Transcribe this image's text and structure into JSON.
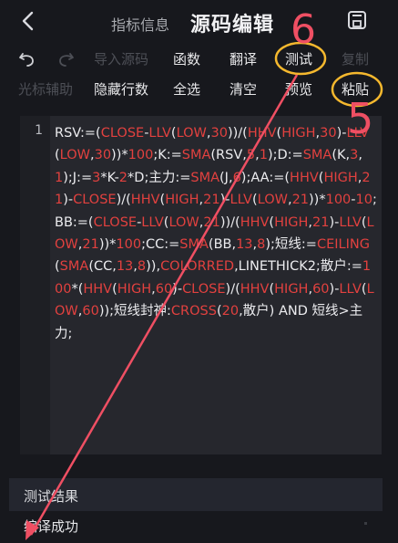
{
  "header": {
    "subtitle": "指标信息",
    "title": "源码编辑"
  },
  "toolbar": {
    "row1": {
      "import": "导入源码",
      "functions": "函数",
      "translate": "翻译",
      "test": "测试",
      "copy": "复制"
    },
    "row2": {
      "cursor_assist": "光标辅助",
      "hide_lines": "隐藏行数",
      "select_all": "全选",
      "clear": "清空",
      "preview": "预览",
      "paste": "粘贴"
    }
  },
  "editor": {
    "line_number": "1",
    "code_segments": [
      [
        "w",
        "RSV:=("
      ],
      [
        "r",
        "CLOSE"
      ],
      [
        "w",
        "-"
      ],
      [
        "r",
        "LLV"
      ],
      [
        "w",
        "("
      ],
      [
        "r",
        "LOW"
      ],
      [
        "w",
        ","
      ],
      [
        "r",
        "30"
      ],
      [
        "w",
        "))/("
      ],
      [
        "r",
        "HHV"
      ],
      [
        "w",
        "("
      ],
      [
        "r",
        "HIGH"
      ],
      [
        "w",
        ","
      ],
      [
        "r",
        "30"
      ],
      [
        "w",
        ")-"
      ],
      [
        "r",
        "LLV"
      ],
      [
        "w",
        "("
      ],
      [
        "r",
        "LOW"
      ],
      [
        "w",
        ","
      ],
      [
        "r",
        "30"
      ],
      [
        "w",
        "))*"
      ],
      [
        "r",
        "100"
      ],
      [
        "w",
        ";K:="
      ],
      [
        "r",
        "SMA"
      ],
      [
        "w",
        "(RSV,"
      ],
      [
        "r",
        "5"
      ],
      [
        "w",
        ","
      ],
      [
        "r",
        "1"
      ],
      [
        "w",
        ");D:="
      ],
      [
        "r",
        "SMA"
      ],
      [
        "w",
        "(K,"
      ],
      [
        "r",
        "3"
      ],
      [
        "w",
        ","
      ],
      [
        "r",
        "1"
      ],
      [
        "w",
        ");J:="
      ],
      [
        "r",
        "3"
      ],
      [
        "w",
        "*K-"
      ],
      [
        "r",
        "2"
      ],
      [
        "w",
        "*D;主力:="
      ],
      [
        "r",
        "SMA"
      ],
      [
        "w",
        "(J,"
      ],
      [
        "r",
        "6"
      ],
      [
        "w",
        ");AA:="
      ],
      [
        "w",
        "("
      ],
      [
        "r",
        "HHV"
      ],
      [
        "w",
        "("
      ],
      [
        "r",
        "HIGH"
      ],
      [
        "w",
        ","
      ],
      [
        "r",
        "21"
      ],
      [
        "w",
        ")-"
      ],
      [
        "r",
        "CLOSE"
      ],
      [
        "w",
        ")/("
      ],
      [
        "r",
        "HHV"
      ],
      [
        "w",
        "("
      ],
      [
        "r",
        "HIGH"
      ],
      [
        "w",
        ","
      ],
      [
        "r",
        "21"
      ],
      [
        "w",
        ")-"
      ],
      [
        "r",
        "LLV"
      ],
      [
        "w",
        "("
      ],
      [
        "r",
        "LOW"
      ],
      [
        "w",
        ","
      ],
      [
        "r",
        "21"
      ],
      [
        "w",
        "))*"
      ],
      [
        "r",
        "100"
      ],
      [
        "w",
        "-"
      ],
      [
        "r",
        "10"
      ],
      [
        "w",
        ";BB:=("
      ],
      [
        "r",
        "CLOSE"
      ],
      [
        "w",
        "-"
      ],
      [
        "r",
        "LLV"
      ],
      [
        "w",
        "("
      ],
      [
        "r",
        "LOW"
      ],
      [
        "w",
        ","
      ],
      [
        "r",
        "21"
      ],
      [
        "w",
        "))/("
      ],
      [
        "r",
        "HHV"
      ],
      [
        "w",
        "("
      ],
      [
        "r",
        "HIGH"
      ],
      [
        "w",
        ","
      ],
      [
        "r",
        "21"
      ],
      [
        "w",
        ")-"
      ],
      [
        "r",
        "LLV"
      ],
      [
        "w",
        "("
      ],
      [
        "r",
        "LOW"
      ],
      [
        "w",
        ","
      ],
      [
        "r",
        "21"
      ],
      [
        "w",
        "))*"
      ],
      [
        "r",
        "100"
      ],
      [
        "w",
        ";CC:="
      ],
      [
        "r",
        "SMA"
      ],
      [
        "w",
        "(BB,"
      ],
      [
        "r",
        "13"
      ],
      [
        "w",
        ","
      ],
      [
        "r",
        "8"
      ],
      [
        "w",
        ");短"
      ],
      [
        "w",
        "线:="
      ],
      [
        "r",
        "CEILING"
      ],
      [
        "w",
        "("
      ],
      [
        "r",
        "SMA"
      ],
      [
        "w",
        "(CC,"
      ],
      [
        "r",
        "13"
      ],
      [
        "w",
        ","
      ],
      [
        "r",
        "8"
      ],
      [
        "w",
        ")),"
      ],
      [
        "r",
        "COLORRED"
      ],
      [
        "w",
        ",LIN"
      ],
      [
        "w",
        "ETHICK2;散户:="
      ],
      [
        "r",
        "100"
      ],
      [
        "w",
        "*("
      ],
      [
        "r",
        "HHV"
      ],
      [
        "w",
        "("
      ],
      [
        "r",
        "HIGH"
      ],
      [
        "w",
        ","
      ],
      [
        "r",
        "60"
      ],
      [
        "w",
        ")-"
      ],
      [
        "r",
        "CLOSE"
      ],
      [
        "w",
        ")/("
      ],
      [
        "r",
        "HHV"
      ],
      [
        "w",
        "("
      ],
      [
        "r",
        "HIGH"
      ],
      [
        "w",
        ","
      ],
      [
        "r",
        "60"
      ],
      [
        "w",
        ")-"
      ],
      [
        "r",
        "LLV"
      ],
      [
        "w",
        "("
      ],
      [
        "r",
        "LOW"
      ],
      [
        "w",
        ","
      ],
      [
        "r",
        "60"
      ],
      [
        "w",
        "));短线"
      ],
      [
        "w",
        "封神:"
      ],
      [
        "r",
        "CROSS"
      ],
      [
        "w",
        "("
      ],
      [
        "r",
        "20"
      ],
      [
        "w",
        ",散户) AND 短线>主力;"
      ]
    ]
  },
  "results": {
    "title": "测试结果",
    "message": "编译成功"
  },
  "annotations": {
    "step_6": "6",
    "step_5": "5",
    "highlight_color": "#f5b82e",
    "arrow_color": "#ef4f63"
  },
  "colors": {
    "background": "#17181d",
    "editor_bg": "#26272d",
    "keyword_red": "#e2413f"
  }
}
